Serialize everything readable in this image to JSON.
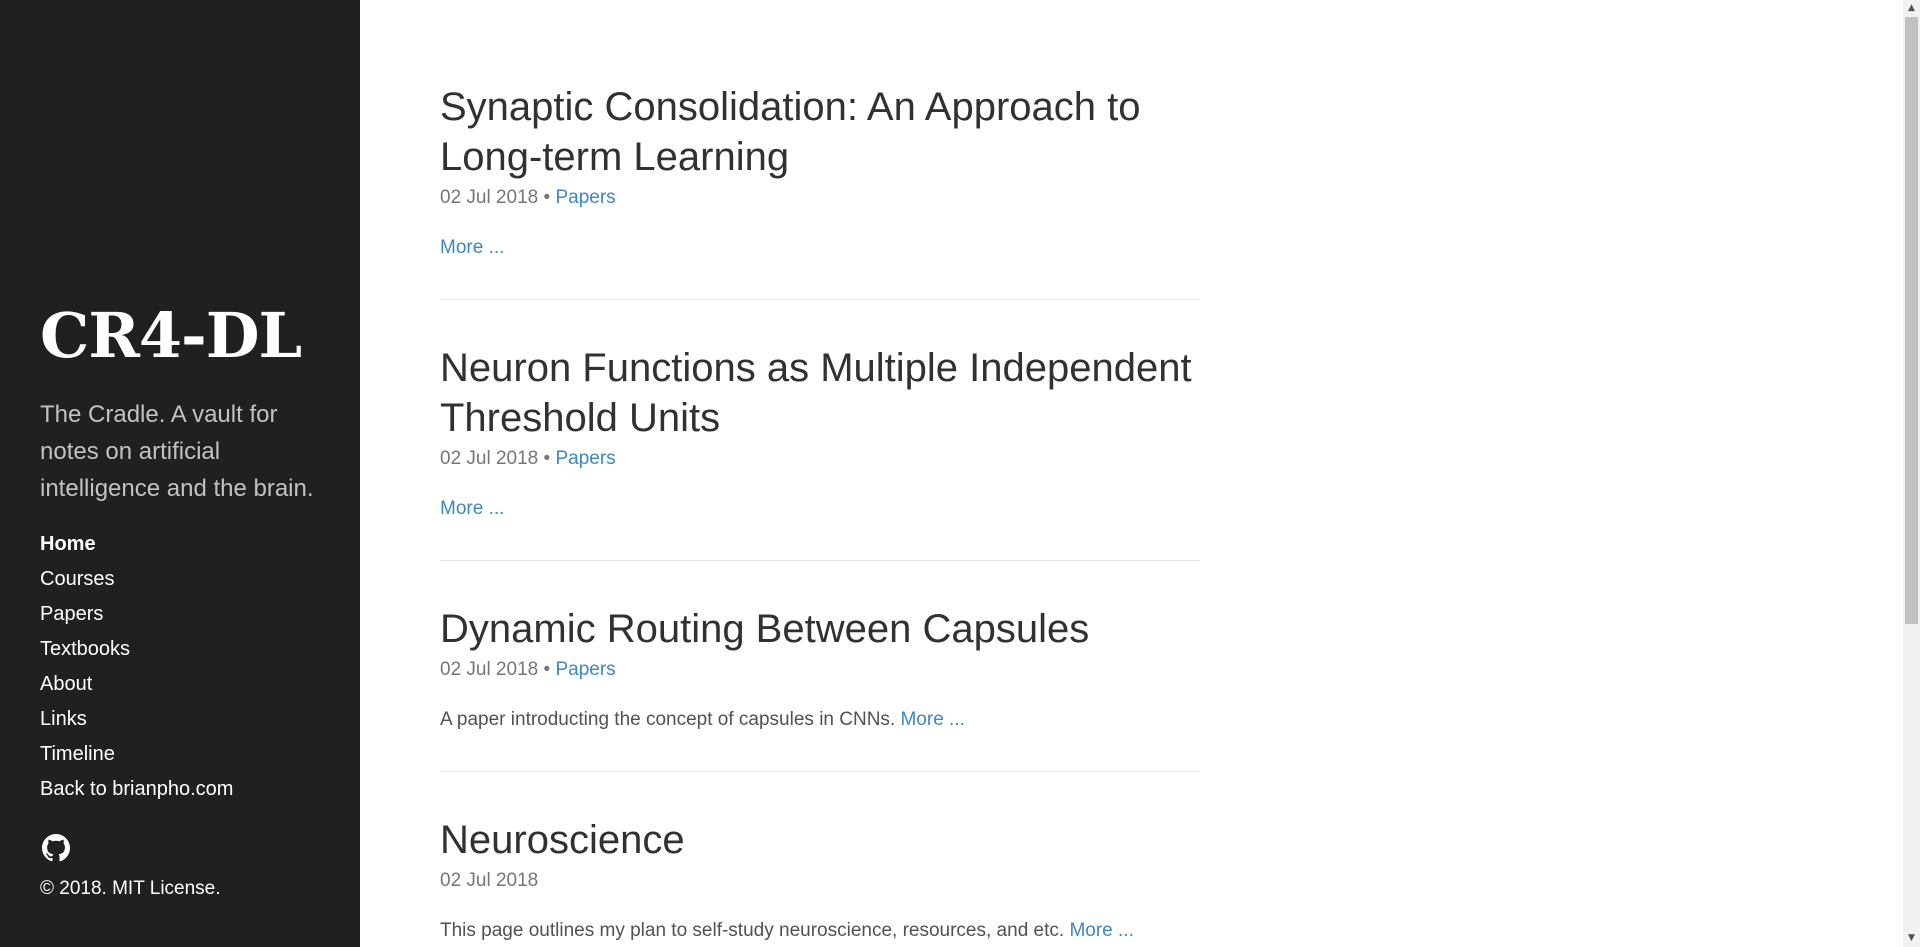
{
  "sidebar": {
    "title": "CR4-DL",
    "description": "The Cradle. A vault for notes on artificial intelligence and the brain.",
    "nav": [
      {
        "label": "Home",
        "active": true
      },
      {
        "label": "Courses",
        "active": false
      },
      {
        "label": "Papers",
        "active": false
      },
      {
        "label": "Textbooks",
        "active": false
      },
      {
        "label": "About",
        "active": false
      },
      {
        "label": "Links",
        "active": false
      },
      {
        "label": "Timeline",
        "active": false
      },
      {
        "label": "Back to brianpho.com",
        "active": false
      }
    ],
    "github_icon": "github-icon",
    "copyright": "© 2018. MIT License."
  },
  "posts": [
    {
      "title": "Synaptic Consolidation: An Approach to Long-term Learning",
      "date": "02 Jul 2018",
      "separator": "•",
      "category": "Papers",
      "excerpt": "",
      "more": "More ..."
    },
    {
      "title": "Neuron Functions as Multiple Independent Threshold Units",
      "date": "02 Jul 2018",
      "separator": "•",
      "category": "Papers",
      "excerpt": "",
      "more": "More ..."
    },
    {
      "title": "Dynamic Routing Between Capsules",
      "date": "02 Jul 2018",
      "separator": "•",
      "category": "Papers",
      "excerpt": "A paper introducting the concept of capsules in CNNs.",
      "more": "More ..."
    },
    {
      "title": "Neuroscience",
      "date": "02 Jul 2018",
      "separator": "",
      "category": "",
      "excerpt": "This page outlines my plan to self-study neuroscience, resources, and etc.",
      "more": "More ..."
    }
  ],
  "colors": {
    "sidebar_bg": "#202020",
    "link": "#3f86c4",
    "text": "#313131",
    "meta": "#767676"
  }
}
